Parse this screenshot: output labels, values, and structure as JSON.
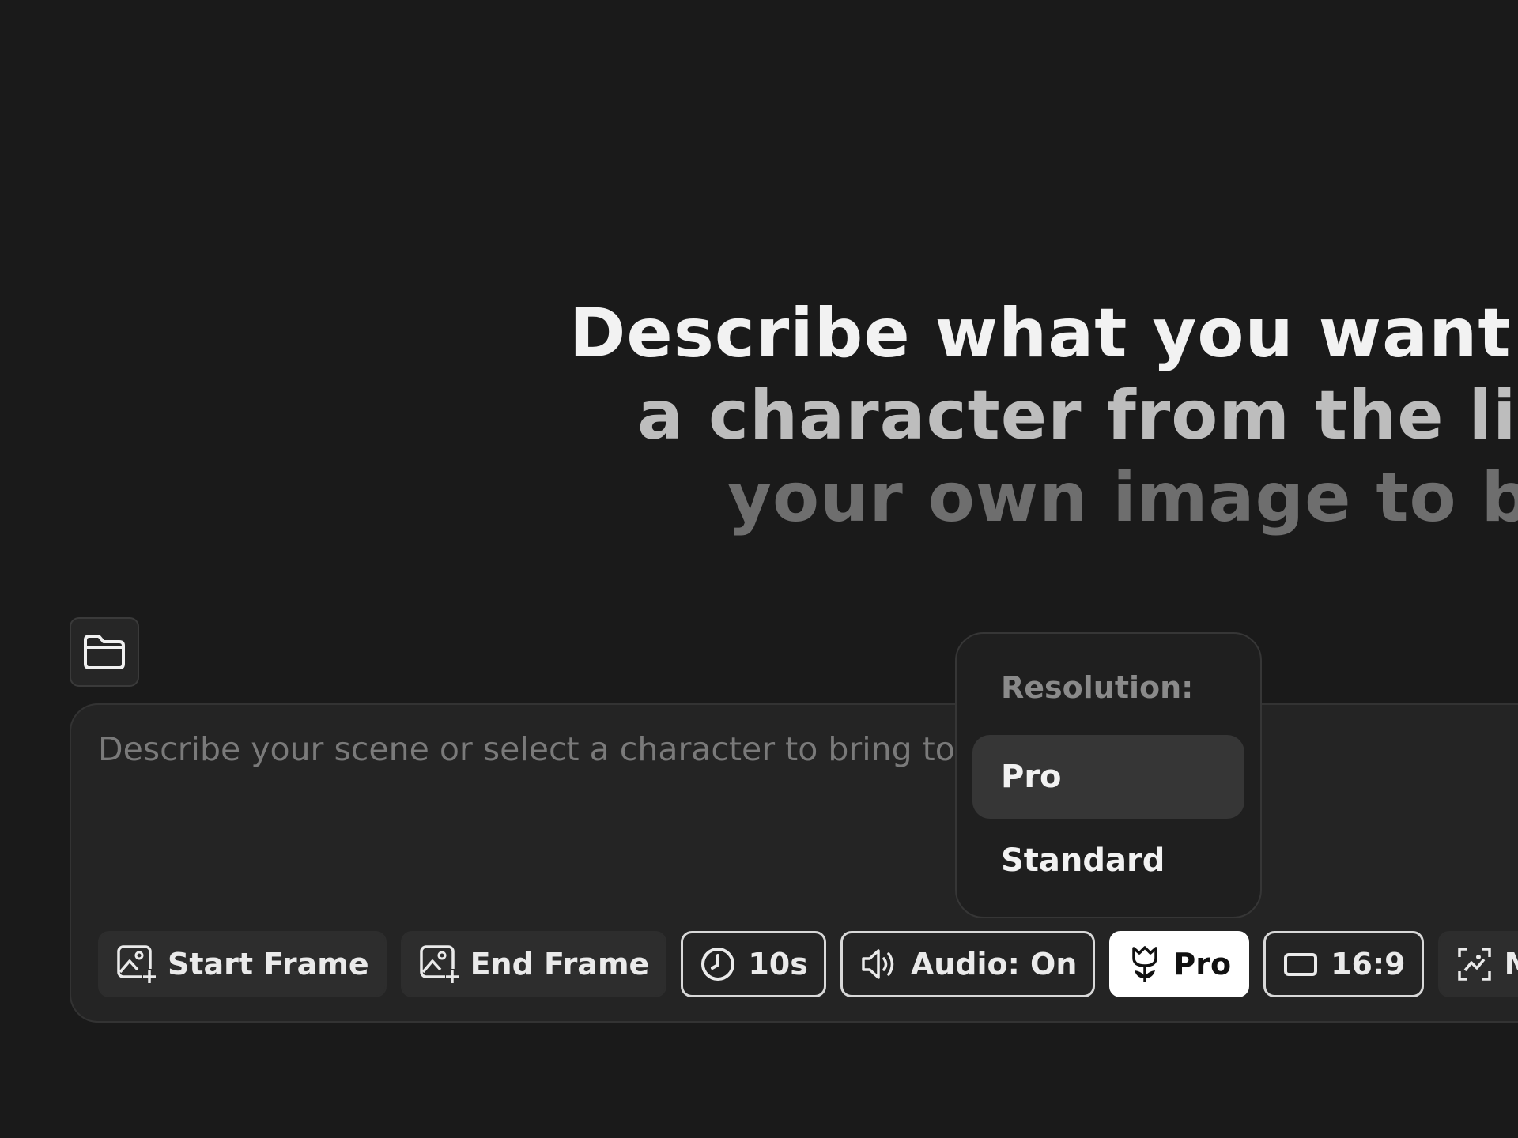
{
  "hero": {
    "line1": "Describe what you want to create or select",
    "line2": "a character from the library, or upload",
    "line3": "your own image to bring it to life"
  },
  "prompt": {
    "placeholder": "Describe your scene or select a character to bring to life..."
  },
  "toolbar": {
    "start_frame": "Start Frame",
    "end_frame": "End Frame",
    "duration": "10s",
    "audio": "Audio: On",
    "resolution": "Pro",
    "aspect_ratio": "16:9",
    "multi": "Multi"
  },
  "dropdown": {
    "label": "Resolution:",
    "options": [
      {
        "label": "Pro",
        "selected": true
      },
      {
        "label": "Standard",
        "selected": false
      }
    ]
  },
  "icons": {
    "folder": "folder-icon",
    "start_frame": "image-add-icon",
    "end_frame": "image-add-icon",
    "duration": "clock-icon",
    "audio": "speaker-icon",
    "resolution": "tulip-icon",
    "aspect_ratio": "rectangle-icon",
    "multi": "scan-icon"
  },
  "colors": {
    "background": "#1a1a1a",
    "panel": "#242424",
    "chip": "#2d2d2d",
    "active_chip": "#ffffff",
    "accent_text": "#f2f2f2"
  }
}
